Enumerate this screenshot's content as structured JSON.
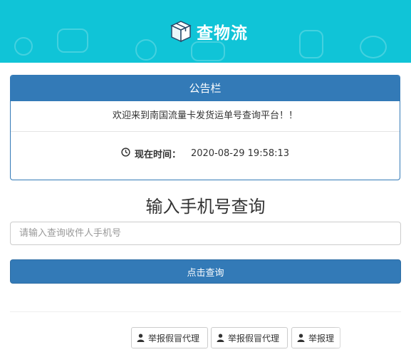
{
  "header": {
    "title": "查物流",
    "logo_icon": "package-box-icon",
    "bg_color": "#10c4d7"
  },
  "notice": {
    "heading": "公告栏",
    "welcome": "欢迎来到南国流量卡发货运单号查询平台！！",
    "time_label": "现在时间：",
    "time_value": "2020-08-29 19:58:13",
    "clock_icon": "clock-icon"
  },
  "search": {
    "title": "输入手机号查询",
    "placeholder": "请输入查询收件人手机号",
    "value": "",
    "button_label": "点击查询",
    "accent_color": "#337ab7"
  },
  "report_buttons": [
    {
      "label": "举报假冒代理",
      "icon": "user-icon"
    },
    {
      "label": "举报假冒代理",
      "icon": "user-icon"
    },
    {
      "label": "举报理",
      "icon": "user-icon"
    }
  ]
}
